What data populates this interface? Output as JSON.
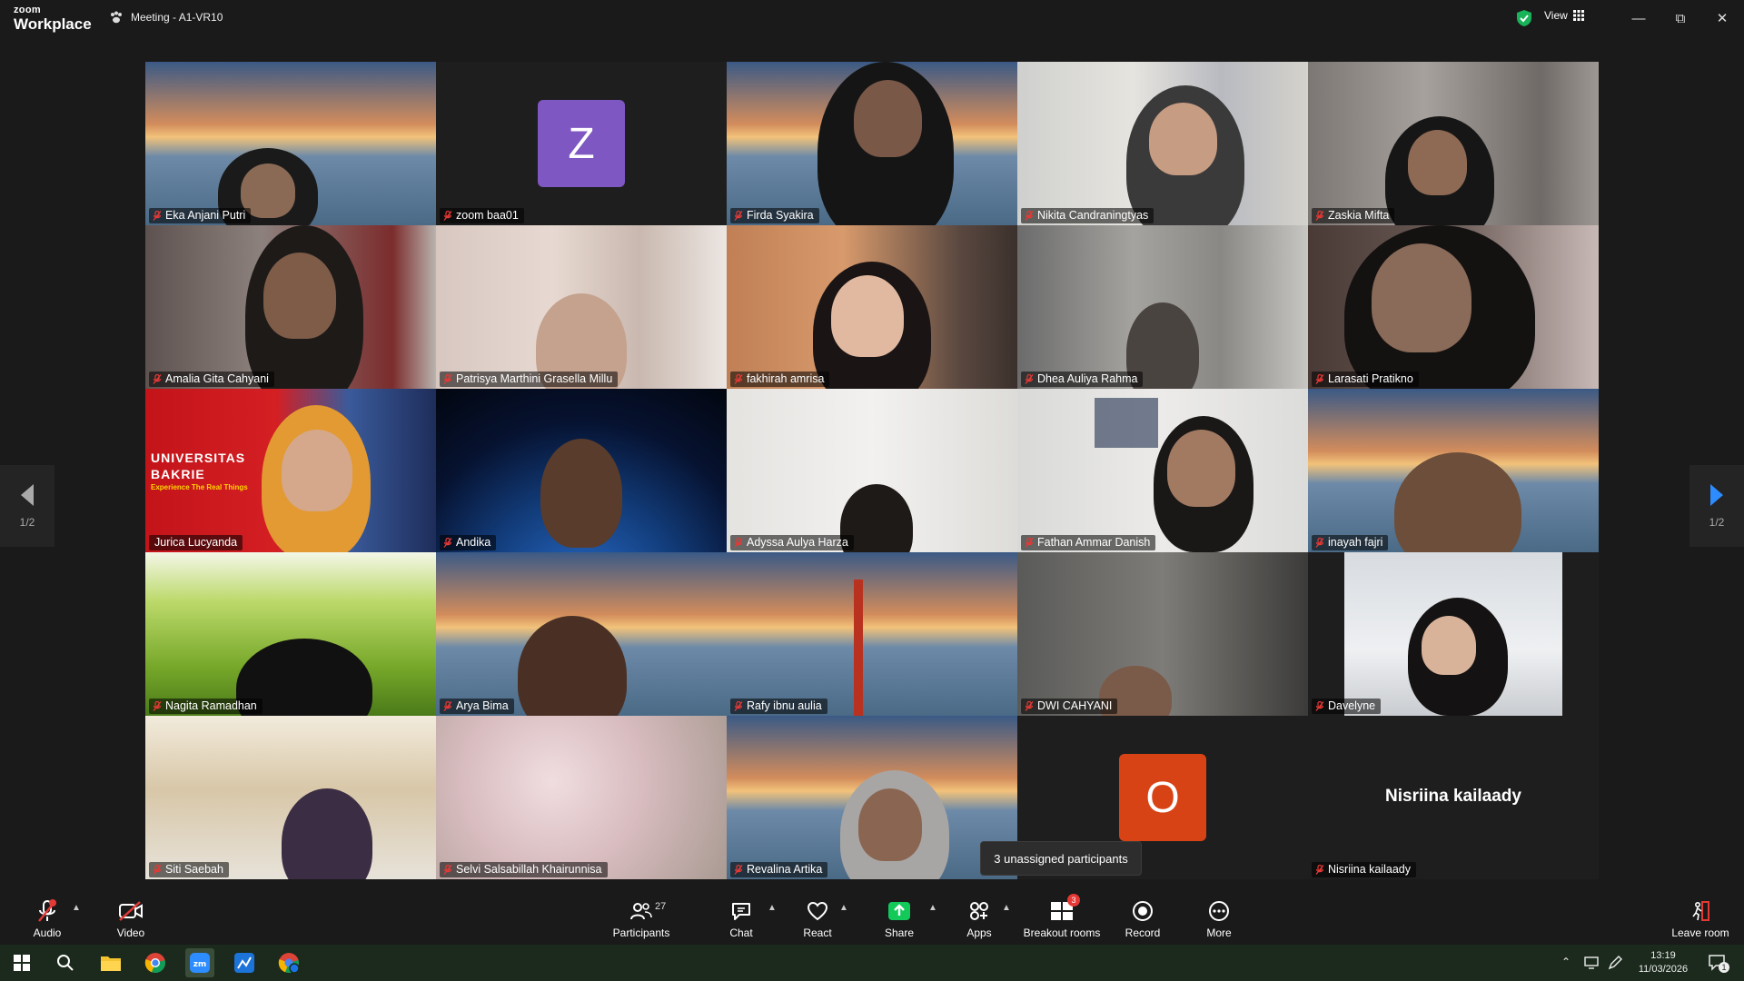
{
  "app": {
    "logo_line1": "zoom",
    "logo_line2": "Workplace",
    "meeting_title": "Meeting - A1-VR10",
    "view_label": "View"
  },
  "participants": [
    {
      "name": "Eka Anjani Putri"
    },
    {
      "name": "zoom baa01",
      "avatar_letter": "Z"
    },
    {
      "name": "Firda Syakira"
    },
    {
      "name": "Nikita Candraningtyas"
    },
    {
      "name": "Zaskia Mifta"
    },
    {
      "name": "Amalia Gita Cahyani"
    },
    {
      "name": "Patrisya Marthini Grasella Millu"
    },
    {
      "name": "fakhirah amrisa"
    },
    {
      "name": "Dhea Auliya Rahma"
    },
    {
      "name": "Larasati Pratikno"
    },
    {
      "name": "Jurica Lucyanda",
      "banner_line1": "UNIVERSITAS",
      "banner_line2": "BAKRIE",
      "banner_tagline": "Experience The Real Things"
    },
    {
      "name": "Andika"
    },
    {
      "name": "Adyssa Aulya Harza"
    },
    {
      "name": "Fathan Ammar Danish"
    },
    {
      "name": "inayah fajri"
    },
    {
      "name": "Nagita Ramadhan"
    },
    {
      "name": "Arya Bima"
    },
    {
      "name": "Rafy ibnu aulia"
    },
    {
      "name": "DWI CAHYANI"
    },
    {
      "name": "Davelyne"
    },
    {
      "name": "Siti Saebah"
    },
    {
      "name": "Selvi Salsabillah Khairunnisa"
    },
    {
      "name": "Revalina Artika"
    },
    {
      "name": "",
      "avatar_letter": "O"
    },
    {
      "name": "Nisriina kailaady",
      "center_name": "Nisriina kailaady"
    }
  ],
  "pagination": {
    "prev_label": "1/2",
    "next_label": "1/2"
  },
  "tooltip": "3 unassigned participants",
  "toolbar": {
    "audio": "Audio",
    "video": "Video",
    "participants": "Participants",
    "participants_count": "27",
    "chat": "Chat",
    "react": "React",
    "share": "Share",
    "apps": "Apps",
    "breakout": "Breakout rooms",
    "breakout_badge": "3",
    "record": "Record",
    "more": "More",
    "leave": "Leave room"
  },
  "taskbar": {
    "time": "13:19",
    "date": "11/03/2026",
    "notif_count": "1"
  },
  "colors": {
    "active_border": "#2ecc71",
    "share_green": "#12c95a",
    "avatar_purple": "#7e57c2",
    "avatar_orange": "#d84315",
    "muted_red": "#e53935"
  }
}
